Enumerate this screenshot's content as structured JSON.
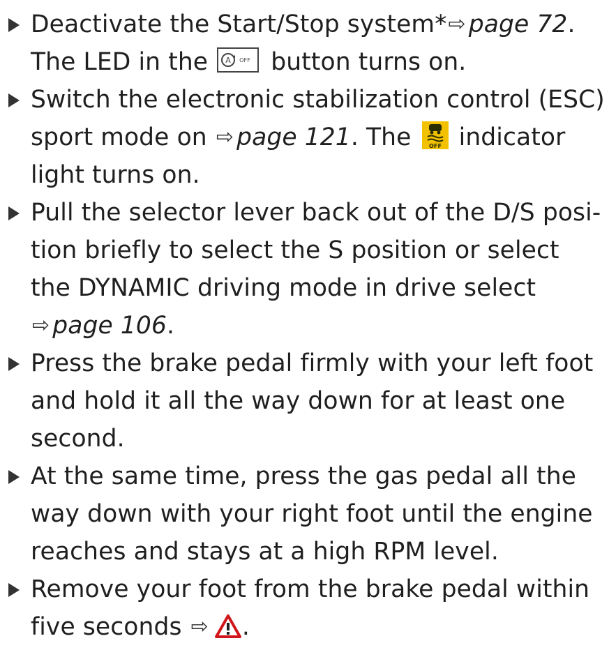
{
  "steps": [
    {
      "p1": "Deactivate the Start/Stop system*",
      "ref": "page 72",
      "p2": ".",
      "p3": "The LED in the",
      "p4": "button turns on.",
      "button_icon": "start-stop-off-button-icon"
    },
    {
      "p1": "Switch the electronic stabilization control (ESC) sport mode on",
      "ref": "page 121",
      "p2": ". The",
      "p3": "indicator light turns on.",
      "indicator_icon": "esc-off-indicator-icon",
      "indicator_color": "#f2c200"
    },
    {
      "p1": "Pull the selector lever back out of the D/S posi-tion briefly to select the S position or select the DYNAMIC driving mode in drive select",
      "ref": "page 106",
      "p2": "."
    },
    {
      "text": "Press the brake pedal firmly with your left foot and hold it all the way down for at least one second."
    },
    {
      "text": "At the same time, press the gas pedal all the way down with your right foot until the engine reaches and stays at a high RPM level."
    },
    {
      "p1": "Remove your foot from the brake pedal within five seconds",
      "p2": ".",
      "warning_icon": "warning-triangle-icon",
      "warning_color": "#d0161b"
    }
  ],
  "arrow_symbol": "⇨"
}
